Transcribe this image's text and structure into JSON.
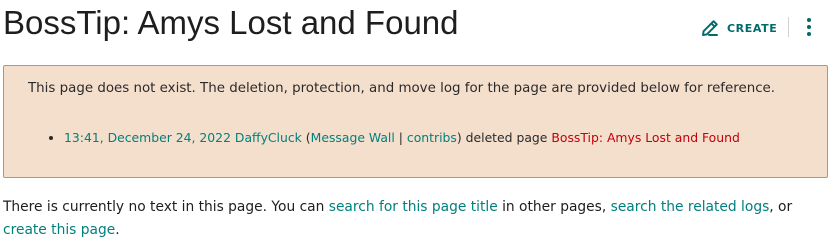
{
  "header": {
    "title": "BossTip: Amys Lost and Found",
    "create_label": "CREATE",
    "create_icon": "pencil-icon",
    "more_icon": "vertical-dots-icon",
    "accent_color": "#006b6b"
  },
  "notice": {
    "text": "This page does not exist. The deletion, protection, and move log for the page are provided below for reference.",
    "background_color": "#f4dfcd",
    "border_color": "#d98f3a",
    "log_entries": [
      {
        "timestamp": "13:41, December 24, 2022",
        "user": "DaffyCluck",
        "open_paren": " (",
        "message_wall": "Message Wall",
        "separator": " | ",
        "contribs": "contribs",
        "action": ") deleted page ",
        "page": "BossTip: Amys Lost and Found"
      }
    ]
  },
  "body": {
    "text_before": "There is currently no text in this page. You can ",
    "search_title_link": "search for this page title",
    "text_middle1": " in other pages, ",
    "search_logs_link": "search the related logs",
    "text_middle2": ", or ",
    "create_link": "create this page",
    "text_end": "."
  }
}
